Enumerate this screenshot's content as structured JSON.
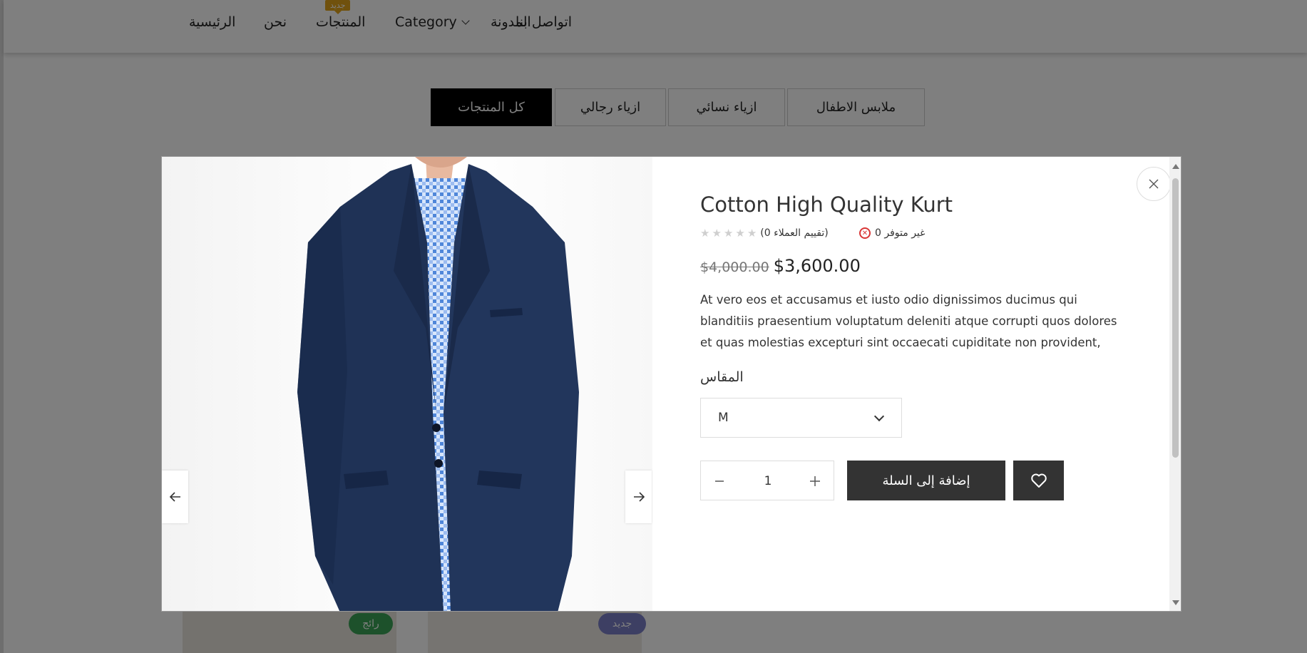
{
  "header": {
    "nav": {
      "home": "الرئيسية",
      "about": "نحن",
      "products": "المنتجات",
      "products_badge": "جديد",
      "category": "Category",
      "blog": "المدونة",
      "contact": "اتواصل بنا"
    }
  },
  "tabs": {
    "all": "كل المنتجات",
    "men": "ازياء رجالي",
    "women": "ازياء نسائي",
    "kids": "ملابس الاطفال"
  },
  "cards": {
    "badge_hot": "رائج",
    "badge_new": "جديد"
  },
  "modal": {
    "title": "Cotton High Quality Kurt",
    "rating": 0,
    "reviews_text": "(تقييم العملاء 0)",
    "stock_text": "غير متوفر 0",
    "old_price": "$4,000.00",
    "new_price": "$3,600.00",
    "description": "At vero eos et accusamus et iusto odio dignissimos ducimus qui blanditiis praesentium voluptatum deleniti atque corrupti quos dolores et quas molestias excepturi sint occaecati cupiditate non provident,",
    "size_label": "المقاس",
    "size_value": "M",
    "qty_value": "1",
    "add_to_cart": "إضافة إلى السلة"
  },
  "colors": {
    "accent_dark": "#333333",
    "badge_orange": "#e0a21a",
    "badge_green": "#3aa356",
    "badge_purple": "#7b7fc7",
    "stock_red": "#d93636"
  }
}
